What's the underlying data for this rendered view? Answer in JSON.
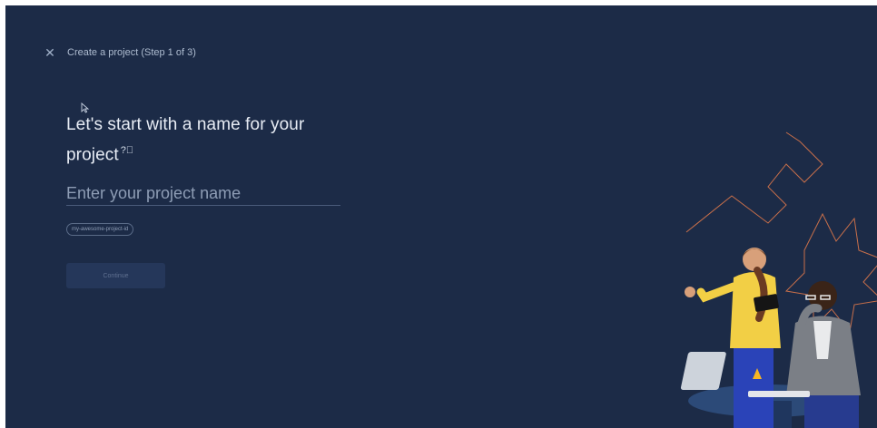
{
  "header": {
    "close_icon": "close-icon",
    "title": "Create a project (Step 1 of 3)"
  },
  "main": {
    "headline": "Let's start with a name for your project",
    "help_icon": "help-circle-icon",
    "name_input": {
      "placeholder": "Enter your project name",
      "value": ""
    },
    "project_id": "my-awesome-project-id",
    "continue_label": "Continue"
  },
  "illustration": {
    "name": "two-people-with-laptop-and-tablet"
  },
  "colors": {
    "background": "#1c2b47",
    "text": "#e8edf5",
    "muted": "#8e9db5",
    "accent_line": "#c86f4a",
    "button_disabled": "#25375a"
  }
}
